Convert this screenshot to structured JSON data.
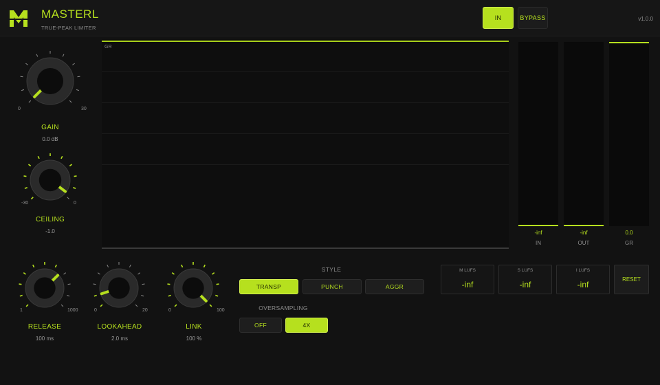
{
  "app": {
    "title": "MASTERL",
    "subtitle": "TRUE-PEAK LIMITER",
    "version": "v1.0.0",
    "logo_letter": "M",
    "accent_color": "#b6e01e"
  },
  "header": {
    "in_label": "IN",
    "bypass_label": "BYPASS",
    "active": "IN"
  },
  "knobs": {
    "gain": {
      "label": "GAIN",
      "value": "0.0 dB",
      "min": "0",
      "max": "30",
      "level": 0.0
    },
    "ceiling": {
      "label": "CEILING",
      "value": "-1.0",
      "min": "-30",
      "max": "0",
      "level": 0.97
    },
    "release": {
      "label": "RELEASE",
      "value": "100 ms",
      "min": "1",
      "max": "1000",
      "level": 0.67
    },
    "lookahead": {
      "label": "LOOKAHEAD",
      "value": "2.0 ms",
      "min": "0",
      "max": "20",
      "level": 0.1
    },
    "link": {
      "label": "LINK",
      "value": "100 %",
      "min": "0",
      "max": "100",
      "level": 1.0
    }
  },
  "graph": {
    "label": "GR"
  },
  "meters": [
    {
      "label": "IN",
      "value": "-inf"
    },
    {
      "label": "OUT",
      "value": "-inf"
    },
    {
      "label": "GR",
      "value": "0.0"
    }
  ],
  "style": {
    "title": "STYLE",
    "options": [
      "TRANSP",
      "PUNCH",
      "AGGR"
    ],
    "selected": "TRANSP"
  },
  "oversampling": {
    "title": "OVERSAMPLING",
    "options": [
      "OFF",
      "4X"
    ],
    "selected": "4X"
  },
  "lufs": [
    {
      "label": "M LUFS",
      "value": "-inf"
    },
    {
      "label": "S LUFS",
      "value": "-inf"
    },
    {
      "label": "I LUFS",
      "value": "-inf"
    }
  ],
  "reset_label": "RESET"
}
